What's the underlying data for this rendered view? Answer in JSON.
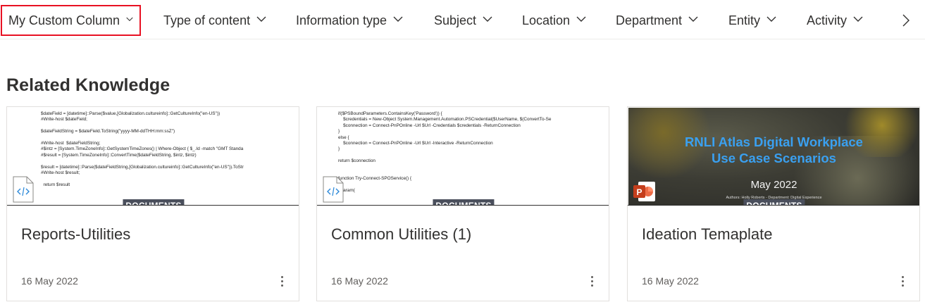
{
  "filters": [
    {
      "label": "My Custom Column",
      "active": true
    },
    {
      "label": "Type of content"
    },
    {
      "label": "Information type"
    },
    {
      "label": "Subject"
    },
    {
      "label": "Location"
    },
    {
      "label": "Department"
    },
    {
      "label": "Entity"
    },
    {
      "label": "Activity"
    }
  ],
  "next_icon": "chevron-right-icon",
  "section": {
    "title": "Related Knowledge"
  },
  "cards": [
    {
      "title": "Reports-Utilities",
      "badge": "DOCUMENTS",
      "date": "16 May 2022",
      "thumb_type": "code",
      "file_icon": "code-file-icon",
      "code": "$dateField = [datetime]::Parse($value,[Globalization.cultureinfo]::GetCultureInfo(\"en-US\"))\n#Write-host $dateField;\n\n$dateFieldString = $dateField.ToString(\"yyyy-MM-ddTHH:mm:ssZ\")\n\n#Write-host  $dateFieldString;\n#$intz = [System.TimeZoneInfo]::GetSystemTimeZones() | Where-Object { $_.Id -match \"GMT Standa\n#$result = [System.TimeZoneInfo]::ConvertTime($dateFieldString, $intz, $intz)\n\n$result = [datetime]::Parse($dateFieldString,[Globalization.cultureinfo]::GetCultureInfo(\"en-US\")).ToStr\n#Write-host $result;\n\n  return $result"
    },
    {
      "title": "Common Utilities (1)",
      "badge": "DOCUMENTS",
      "date": "16 May 2022",
      "thumb_type": "code",
      "file_icon": "code-file-icon",
      "code": "if($PSBoundParameters.ContainsKey('Password')) {\n    $credentials = New-Object System.Management.Automation.PSCredential($UserName, $(ConvertTo-Se\n    $connection = Connect-PnPOnline -Url $Url -Credentials $credentials -ReturnConnection\n}\nelse {\n    $connection = Connect-PnPOnline -Url $Url -Interactive -ReturnConnection\n}\n\nreturn $connection\n\n\nfunction Try-Connect-SPOService() {\n\n  param("
    },
    {
      "title": "Ideation Temaplate",
      "badge": "DOCUMENTS",
      "date": "16 May 2022",
      "thumb_type": "ppt",
      "file_icon": "powerpoint-icon",
      "slide_title_1": "RNLI Atlas Digital Workplace",
      "slide_title_2": "Use Case Scenarios",
      "slide_date": "May 2022",
      "slide_author": "Authors: Holly Roberts - Department: Digital Experience"
    }
  ],
  "colors": {
    "active_border": "#e81123",
    "badge_bg": "#4a4f5c",
    "slide_title": "#3aa0f0"
  }
}
